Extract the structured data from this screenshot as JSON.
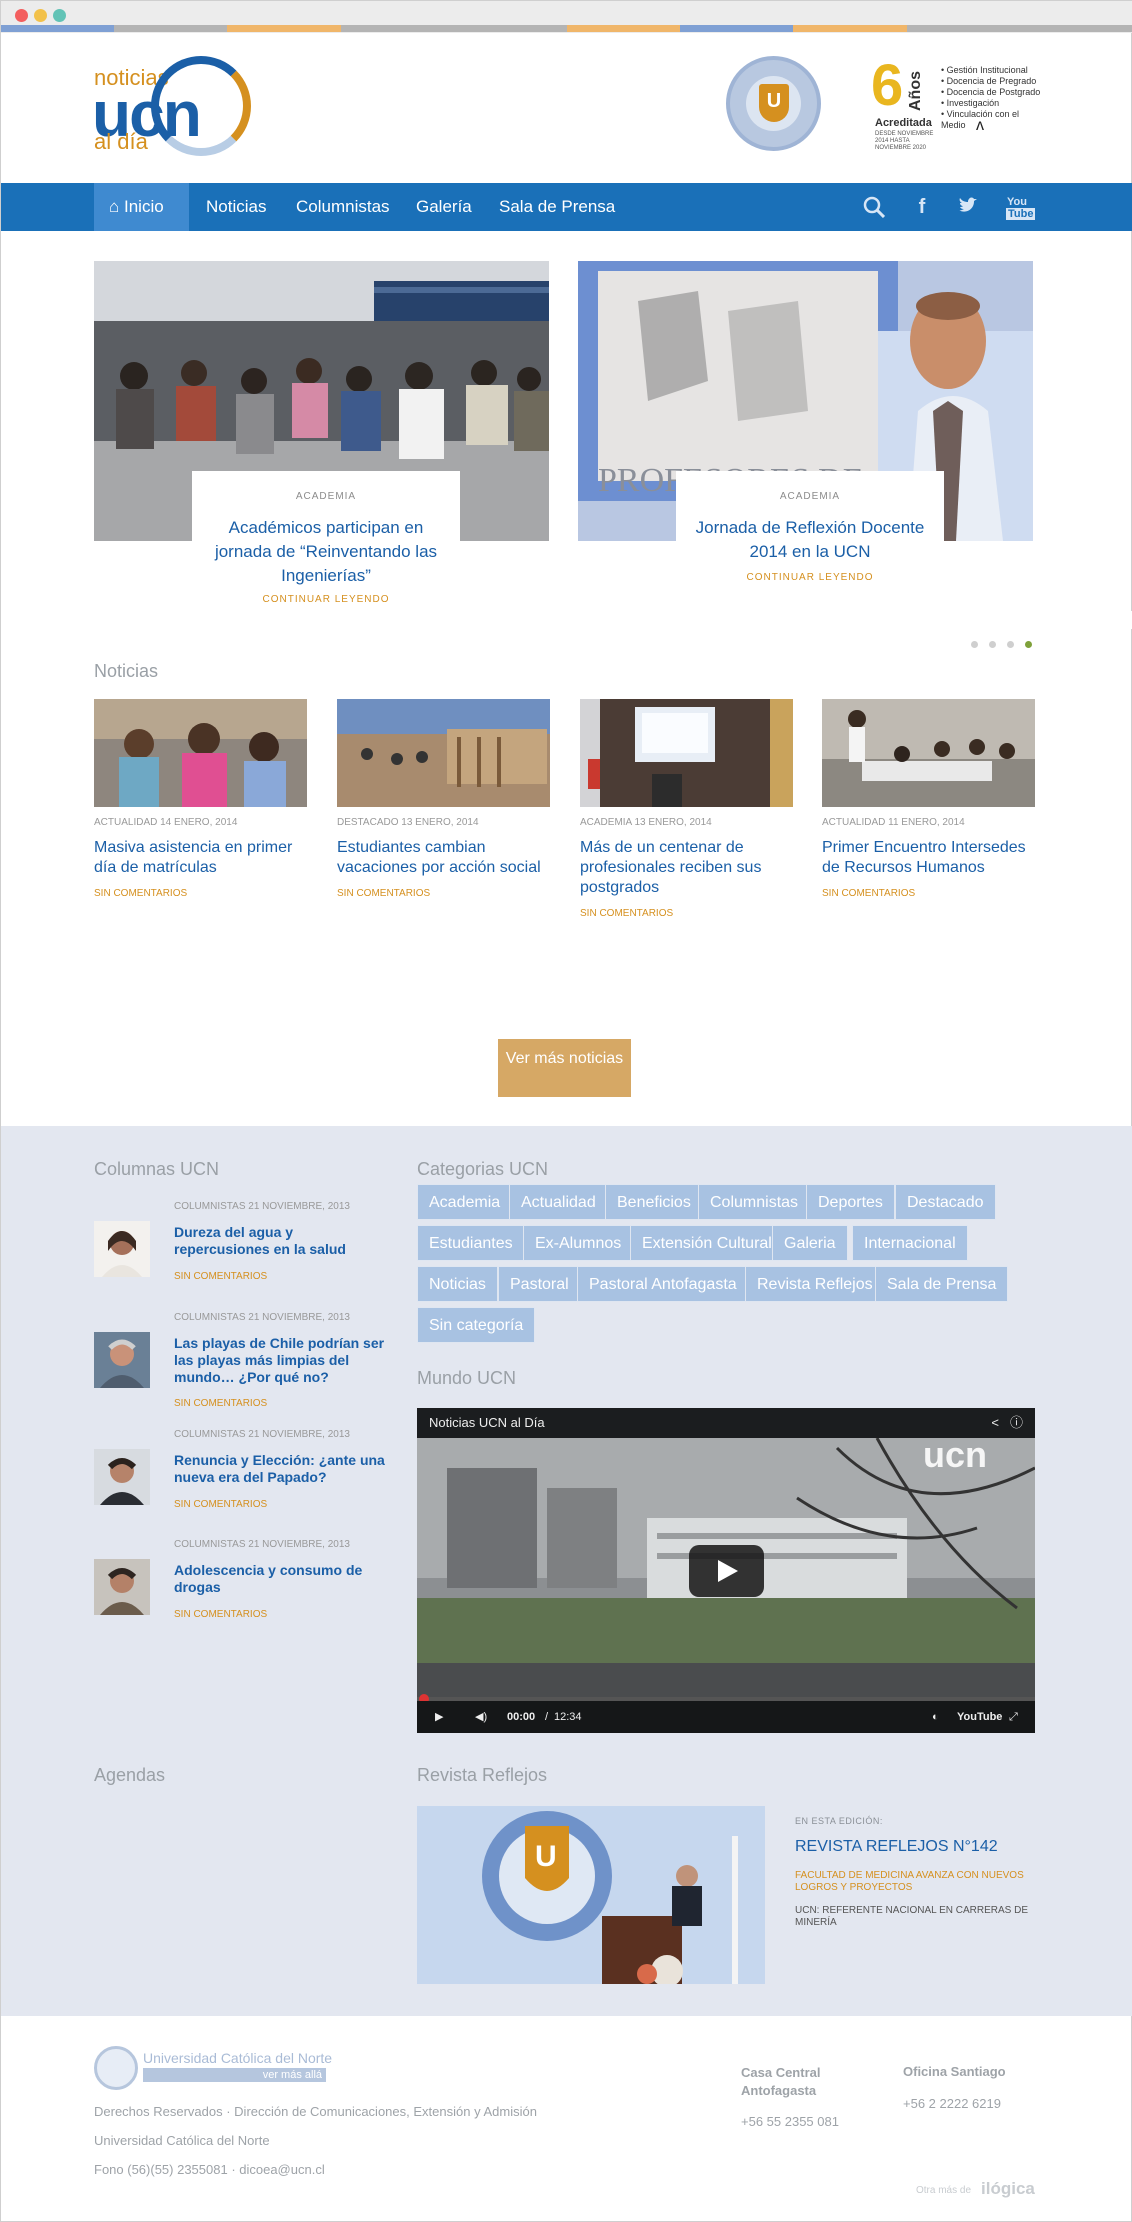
{
  "header": {
    "logo_noticias": "noticias",
    "logo_ucn": "ucn",
    "logo_aldia": "al día",
    "accreditation": {
      "years": "6",
      "years_word": "Años",
      "label": "Acreditada",
      "dates": "DESDE NOVIEMBRE 2014 HASTA NOVIEMBRE 2020",
      "areas": [
        "Gestión Institucional",
        "Docencia de Pregrado",
        "Docencia de Postgrado",
        "Investigación",
        "Vinculación con el Medio"
      ]
    }
  },
  "nav": {
    "items": [
      "Inicio",
      "Noticias",
      "Columnistas",
      "Galería",
      "Sala de Prensa"
    ],
    "icons": [
      "search-icon",
      "facebook-icon",
      "twitter-icon",
      "youtube-icon"
    ]
  },
  "slider": {
    "slides": [
      {
        "category": "ACADEMIA",
        "title": "Académicos participan en jornada de “Reinventando las Ingenierías”",
        "more": "CONTINUAR LEYENDO"
      },
      {
        "category": "ACADEMIA",
        "title": "Jornada de Reflexión Docente 2014 en la UCN",
        "more": "CONTINUAR LEYENDO"
      }
    ],
    "active_page": 4,
    "pages": 4
  },
  "noticias": {
    "title": "Noticias",
    "items": [
      {
        "meta": "ACTUALIDAD 14 ENERO, 2014",
        "title": "Masiva asistencia en primer día de matrículas",
        "comments": "SIN COMENTARIOS"
      },
      {
        "meta": "DESTACADO 13 ENERO, 2014",
        "title": "Estudiantes cambian vacaciones por acción social",
        "comments": "SIN COMENTARIOS"
      },
      {
        "meta": "ACADEMIA 13 ENERO, 2014",
        "title": "Más de un centenar de profesionales reciben sus postgrados",
        "comments": "SIN COMENTARIOS"
      },
      {
        "meta": "ACTUALIDAD 11 ENERO, 2014",
        "title": "Primer Encuentro Intersedes de Recursos Humanos",
        "comments": "SIN COMENTARIOS"
      }
    ],
    "more_button": "Ver más noticias"
  },
  "columnas": {
    "title": "Columnas UCN",
    "items": [
      {
        "meta": "COLUMNISTAS 21 NOVIEMBRE, 2013",
        "title": "Dureza del agua y repercusiones en la salud",
        "comments": "SIN COMENTARIOS"
      },
      {
        "meta": "COLUMNISTAS 21 NOVIEMBRE, 2013",
        "title": "Las playas de Chile podrían ser las playas más limpias del mundo… ¿Por qué no?",
        "comments": "SIN COMENTARIOS"
      },
      {
        "meta": "COLUMNISTAS 21 NOVIEMBRE, 2013",
        "title": "Renuncia y Elección: ¿ante una nueva era del Papado?",
        "comments": "SIN COMENTARIOS"
      },
      {
        "meta": "COLUMNISTAS 21 NOVIEMBRE, 2013",
        "title": "Adolescencia y consumo de drogas",
        "comments": "SIN COMENTARIOS"
      }
    ]
  },
  "categorias": {
    "title": "Categorias UCN",
    "tags": [
      "Academia",
      "Actualidad",
      "Beneficios",
      "Columnistas",
      "Deportes",
      "Destacado",
      "Estudiantes",
      "Ex-Alumnos",
      "Extensión Cultural",
      "Galeria",
      "Internacional",
      "Noticias",
      "Pastoral",
      "Pastoral Antofagasta",
      "Revista Reflejos",
      "Sala de Prensa",
      "Sin categoría"
    ]
  },
  "mundo": {
    "title": "Mundo UCN",
    "video_title": "Noticias UCN al Día",
    "time_current": "00:00",
    "time_total": "12:34",
    "watermark": "ucn",
    "brand": "YouTube"
  },
  "agendas": {
    "title": "Agendas"
  },
  "revista": {
    "title": "Revista Reflejos",
    "edition_label": "EN ESTA EDICIÓN:",
    "issue": "REVISTA REFLEJOS N°142",
    "headline1": "FACULTAD DE MEDICINA AVANZA CON NUEVOS LOGROS Y PROYECTOS",
    "headline2": "UCN: REFERENTE NACIONAL EN CARRERAS DE MINERÍA"
  },
  "footer": {
    "uni_name": "Universidad Católica del Norte",
    "tagline": "ver más allá",
    "rights": "Derechos Reservados · Dirección de Comunicaciones, Extensión y Admisión",
    "uni": "Universidad Católica del Norte",
    "contact": "Fono (56)(55) 2355081 · dicoea@ucn.cl",
    "office1_name": "Casa Central Antofagasta",
    "office1_phone": "+56 55 2355 081",
    "office2_name": "Oficina Santiago",
    "office2_phone": "+56 2 2222 6219",
    "credit_prefix": "Otra más de",
    "credit_brand": "ilógica"
  },
  "colors": {
    "blue": "#1a70b8",
    "gold": "#d5901f",
    "light_bg": "#e3e7f0",
    "tag": "#a8c2e2"
  }
}
